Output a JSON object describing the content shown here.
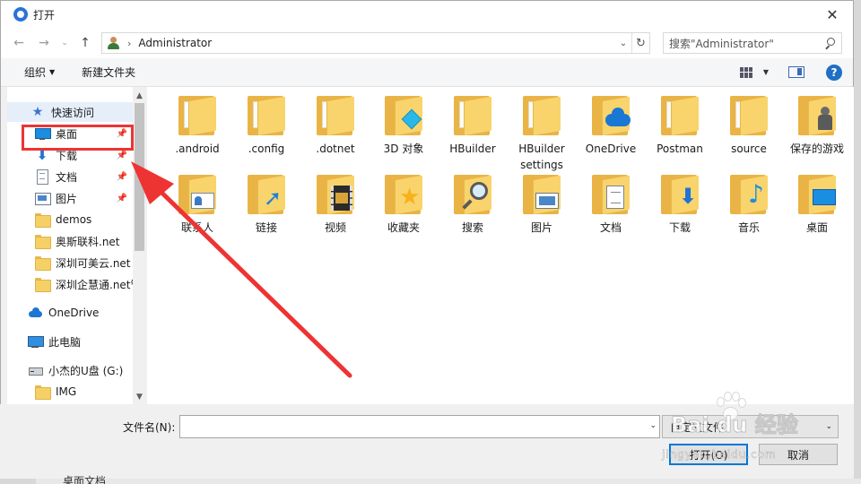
{
  "window": {
    "title": "打开",
    "close_symbol": "✕"
  },
  "nav": {
    "back_symbol": "←",
    "forward_symbol": "→",
    "recent_symbol": "⌄",
    "up_symbol": "↑",
    "address_separator": "›",
    "address": "Administrator",
    "address_dropdown_symbol": "⌄",
    "refresh_symbol": "↻",
    "search_placeholder": "搜索\"Administrator\""
  },
  "toolbar": {
    "organize": "组织",
    "dropdown_symbol": "▼",
    "new_folder": "新建文件夹",
    "help_symbol": "?"
  },
  "sidebar": {
    "items": [
      {
        "label": "快速访问",
        "icon": "star-icon",
        "pinned": false,
        "header": true
      },
      {
        "label": "桌面",
        "icon": "desktop-icon",
        "pinned": true
      },
      {
        "label": "下载",
        "icon": "download-icon",
        "pinned": true
      },
      {
        "label": "文档",
        "icon": "document-icon",
        "pinned": true
      },
      {
        "label": "图片",
        "icon": "pictures-icon",
        "pinned": true
      },
      {
        "label": "demos",
        "icon": "folder-icon",
        "pinned": false
      },
      {
        "label": "奥斯联科.net",
        "icon": "folder-icon",
        "pinned": false
      },
      {
        "label": "深圳可美云.net",
        "icon": "folder-icon",
        "pinned": false
      },
      {
        "label": "深圳企慧通.net管",
        "icon": "folder-icon",
        "pinned": false
      },
      {
        "label": "OneDrive",
        "icon": "onedrive-icon",
        "pinned": false
      },
      {
        "label": "此电脑",
        "icon": "this-pc-icon",
        "pinned": false
      },
      {
        "label": "小杰的U盘 (G:)",
        "icon": "usb-drive-icon",
        "pinned": false
      },
      {
        "label": "IMG",
        "icon": "folder-icon",
        "pinned": false
      }
    ],
    "pin_symbol": "📌",
    "scroll_up_symbol": "▲",
    "scroll_down_symbol": "▼"
  },
  "files": [
    {
      "name": ".android",
      "overlay": "none"
    },
    {
      "name": ".config",
      "overlay": "none"
    },
    {
      "name": ".dotnet",
      "overlay": "none"
    },
    {
      "name": "3D 对象",
      "overlay": "cube"
    },
    {
      "name": "HBuilder",
      "overlay": "none"
    },
    {
      "name": "HBuilder settings",
      "overlay": "none"
    },
    {
      "name": "OneDrive",
      "overlay": "cloud"
    },
    {
      "name": "Postman",
      "overlay": "none"
    },
    {
      "name": "source",
      "overlay": "none"
    },
    {
      "name": "保存的游戏",
      "overlay": "chess"
    },
    {
      "name": "联系人",
      "overlay": "card"
    },
    {
      "name": "链接",
      "overlay": "arrow"
    },
    {
      "name": "视频",
      "overlay": "film"
    },
    {
      "name": "收藏夹",
      "overlay": "star"
    },
    {
      "name": "搜索",
      "overlay": "magnifier"
    },
    {
      "name": "图片",
      "overlay": "picture"
    },
    {
      "name": "文档",
      "overlay": "document"
    },
    {
      "name": "下载",
      "overlay": "download"
    },
    {
      "name": "音乐",
      "overlay": "music"
    },
    {
      "name": "桌面",
      "overlay": "desktop"
    }
  ],
  "bottom": {
    "filename_label": "文件名(N):",
    "filename_value": "",
    "filename_dropdown_symbol": "⌄",
    "filetype_value": "自定义文件",
    "filetype_dropdown_symbol": "⌄",
    "open_button": "打开(O)",
    "cancel_button": "取消"
  },
  "background": {
    "desktop_text": "桌面文档"
  },
  "annotation": {
    "color": "#ee3333"
  },
  "watermark": {
    "logo_text": "Bai  du 经验",
    "url": "jingyan.baidu.com"
  }
}
